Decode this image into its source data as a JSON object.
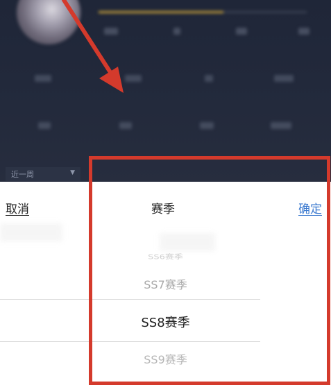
{
  "background": {
    "period_select_label": "近一周",
    "blur_stats_row1": [
      "",
      "",
      "",
      ""
    ],
    "progress_fraction": 0.6
  },
  "picker": {
    "cancel_label": "取消",
    "title": "赛季",
    "confirm_label": "确定",
    "options": [
      "SS6赛季",
      "SS7赛季",
      "SS8赛季",
      "SS9赛季"
    ],
    "selected": "SS8赛季"
  },
  "colors": {
    "annotation_red": "#d43a2c",
    "confirm_blue": "#3b79cf",
    "progress_gold": "#c9a23a",
    "background_dark": "#232a3c"
  },
  "icons": {
    "dropdown": "chevron-down-icon",
    "annotation_arrow": "arrow-icon"
  }
}
